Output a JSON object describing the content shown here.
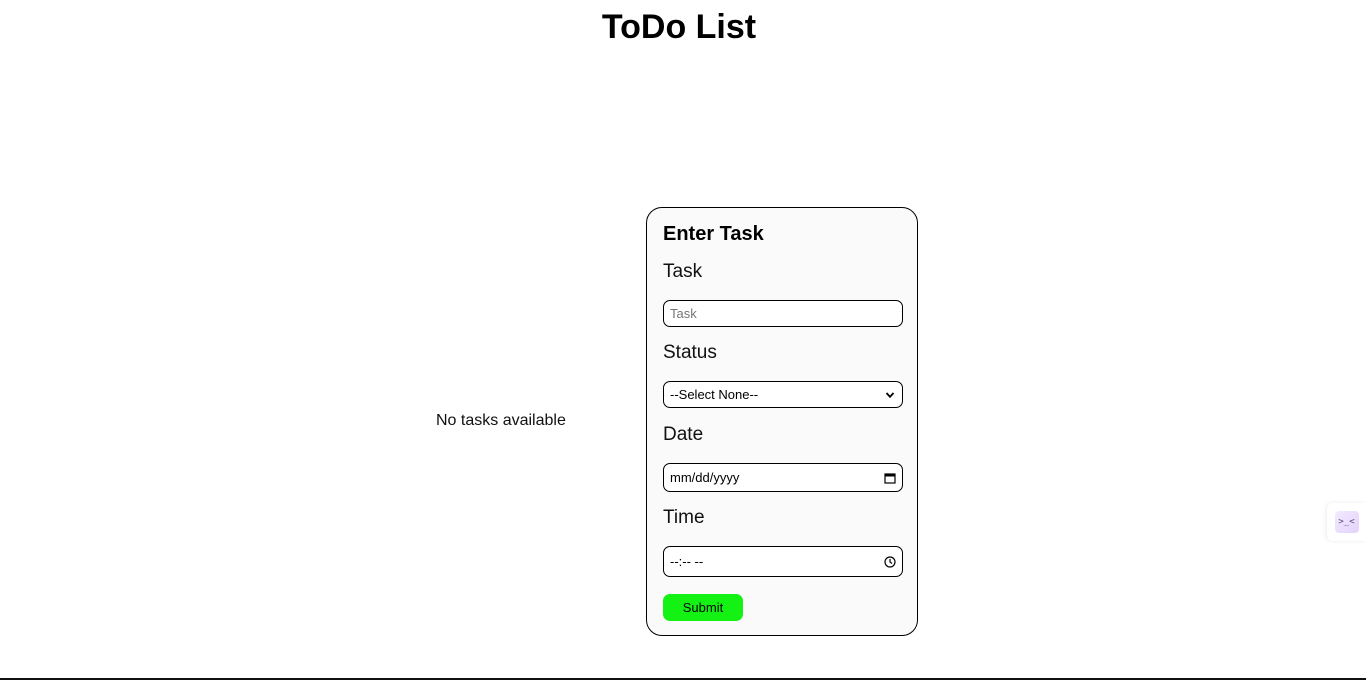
{
  "page": {
    "title": "ToDo List",
    "empty_message": "No tasks available"
  },
  "form": {
    "heading": "Enter Task",
    "task": {
      "label": "Task",
      "placeholder": "Task"
    },
    "status": {
      "label": "Status",
      "selected": "--Select None--"
    },
    "date": {
      "label": "Date",
      "value": "mm/dd/yyyy",
      "icon": "calendar-icon"
    },
    "time": {
      "label": "Time",
      "value": "--:-- --",
      "icon": "clock-icon"
    },
    "submit_label": "Submit"
  },
  "widget": {
    "icon_text": ">_<"
  },
  "colors": {
    "submit_bg": "#14f214",
    "card_bg": "#fafafa",
    "border": "#000000"
  }
}
